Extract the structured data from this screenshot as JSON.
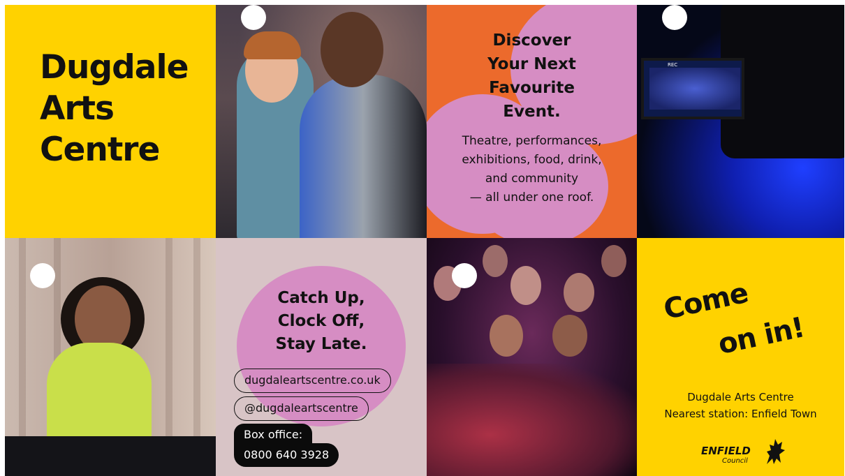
{
  "panels": {
    "title": {
      "heading": "Dugdale\nArts\nCentre"
    },
    "discover": {
      "heading": "Discover\nYour Next\nFavourite\nEvent.",
      "body": "Theatre, performances,\nexhibitions, food, drink,\nand community\n— all under one roof."
    },
    "camera": {
      "rec_label": "REC"
    },
    "catchup": {
      "heading": "Catch Up,\nClock Off,\nStay Late.",
      "website": "dugdaleartscentre.co.uk",
      "social": "@dugdaleartscentre",
      "box_office_label": "Box office:",
      "box_office_number": "0800 640 3928"
    },
    "come_in": {
      "line1": "Come",
      "line2": "on in!",
      "venue_name": "Dugdale Arts Centre",
      "station": "Nearest station: Enfield Town",
      "logo_main": "ENFIELD",
      "logo_sub": "Council"
    }
  },
  "colors": {
    "yellow": "#FFD200",
    "orange": "#EC6A2C",
    "pink": "#D68DC3",
    "blush": "#D8C4C6",
    "black": "#111111"
  },
  "icons": [
    "white-dot-icon",
    "enfield-dragon-icon"
  ]
}
